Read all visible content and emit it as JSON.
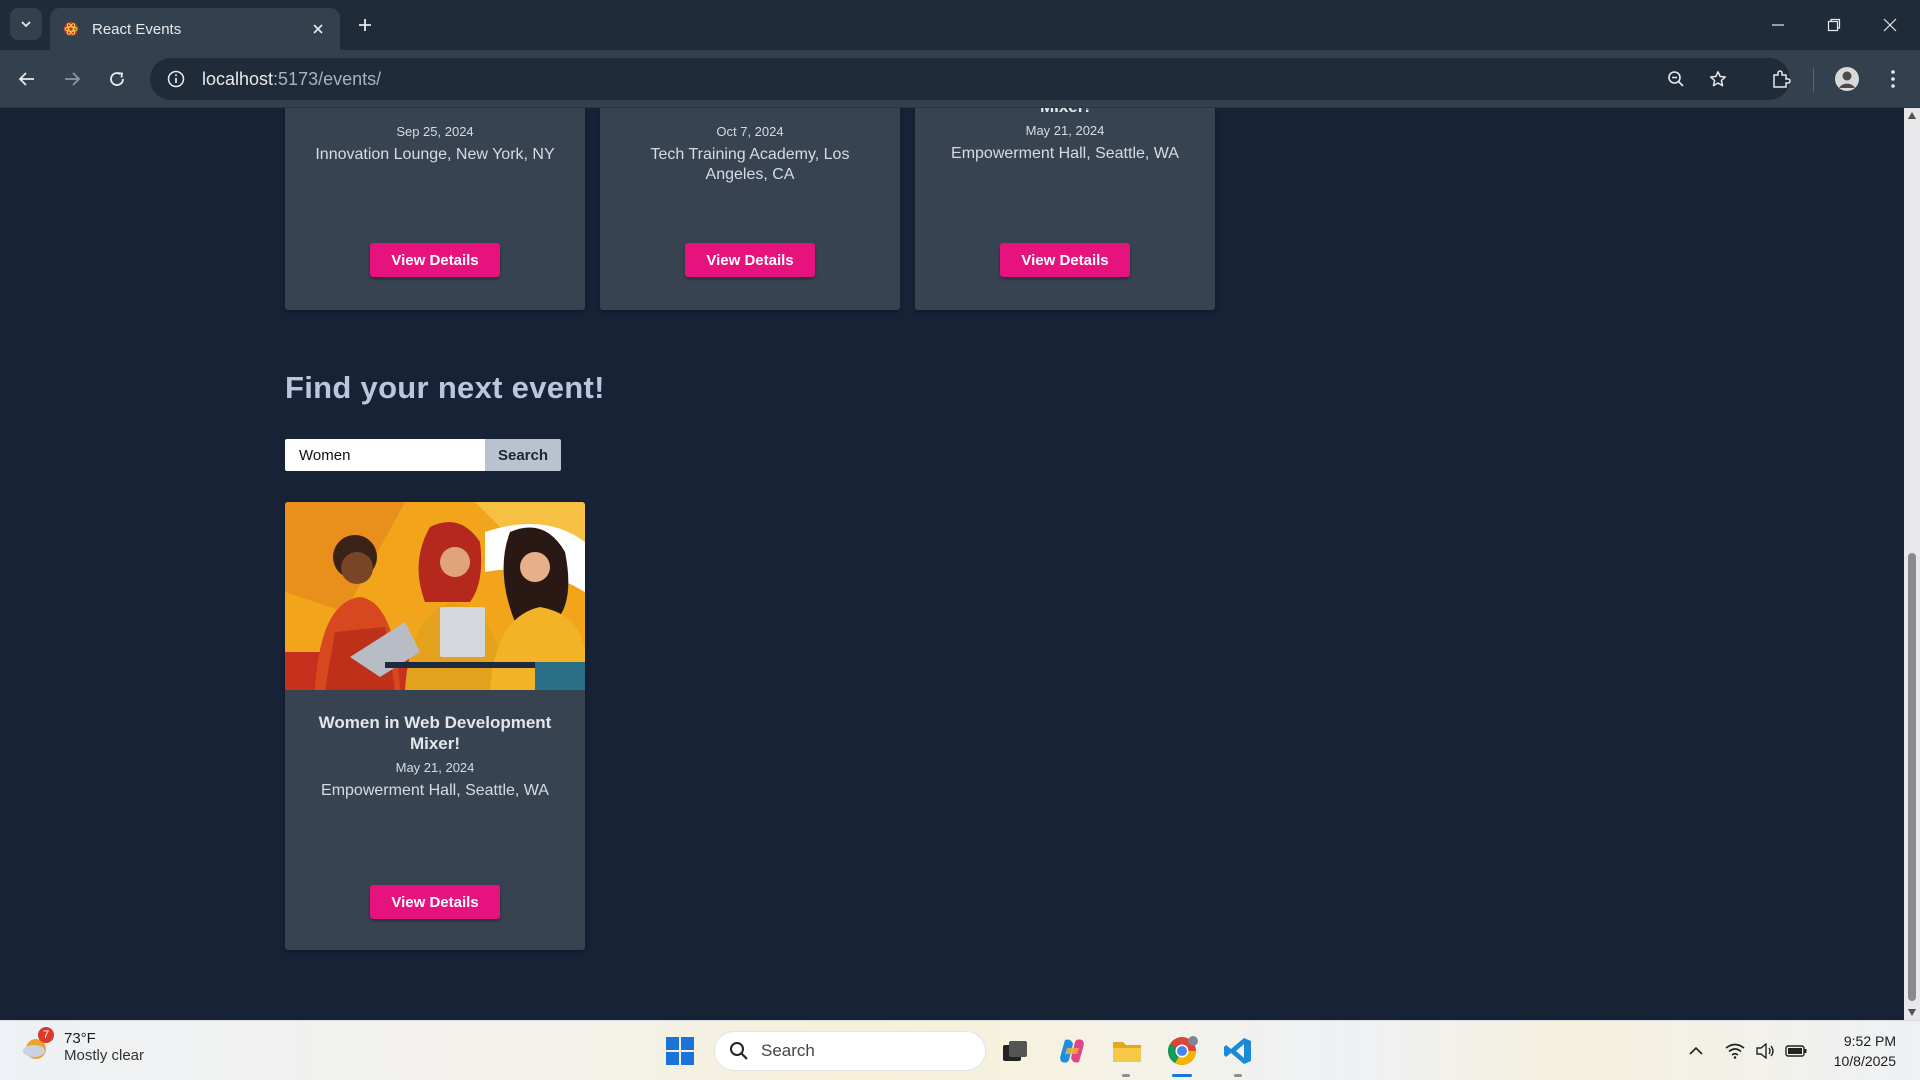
{
  "browser": {
    "tab_title": "React Events",
    "url_host": "localhost",
    "url_path": ":5173/events/"
  },
  "top_cards": [
    {
      "date": "Sep 25, 2024",
      "location": "Innovation Lounge, New York, NY",
      "button": "View Details"
    },
    {
      "date": "Oct 7, 2024",
      "location": "Tech Training Academy, Los Angeles, CA",
      "button": "View Details"
    },
    {
      "title_tail": "Mixer!",
      "date": "May 21, 2024",
      "location": "Empowerment Hall, Seattle, WA",
      "button": "View Details"
    }
  ],
  "search_section": {
    "heading": "Find your next event!",
    "query": "Women",
    "button": "Search"
  },
  "results": [
    {
      "title": "Women in Web Development Mixer!",
      "date": "May 21, 2024",
      "location": "Empowerment Hall, Seattle, WA",
      "button": "View Details"
    }
  ],
  "taskbar": {
    "weather_badge": "7",
    "temperature": "73°F",
    "condition": "Mostly clear",
    "search_label": "Search",
    "time": "9:52 PM",
    "date": "10/8/2025"
  },
  "colors": {
    "accent": "#e6127e",
    "page_bg": "#172236",
    "card_bg": "#384352",
    "heading": "#b9c7dc"
  }
}
